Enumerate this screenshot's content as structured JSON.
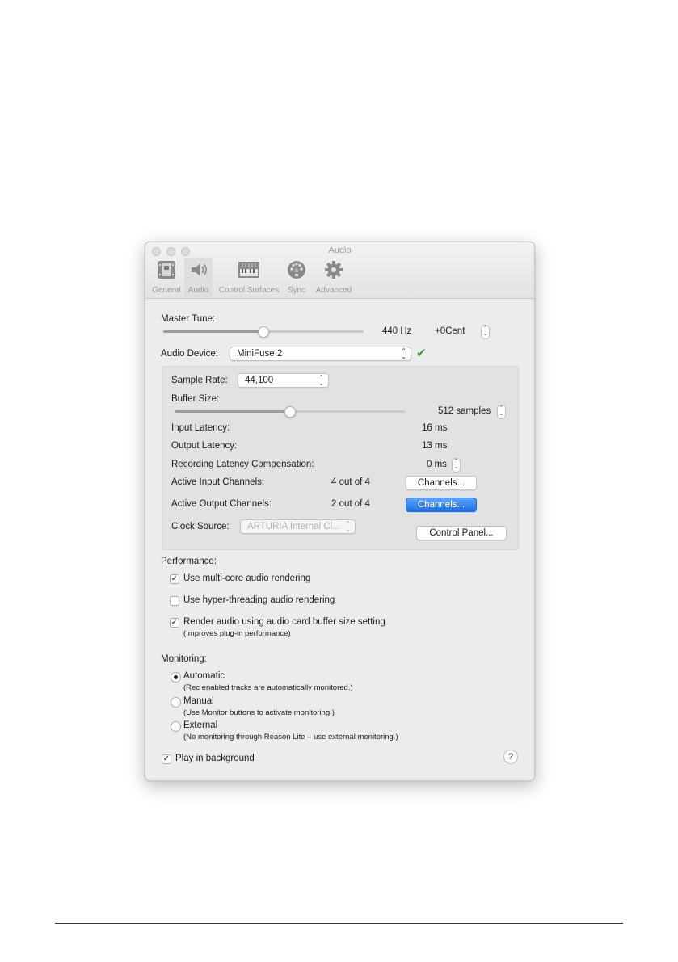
{
  "window": {
    "title": "Audio"
  },
  "tabs": [
    {
      "label": "General",
      "icon": "general-icon"
    },
    {
      "label": "Audio",
      "icon": "speaker-icon"
    },
    {
      "label": "Control Surfaces",
      "icon": "keyboard-icon"
    },
    {
      "label": "Sync",
      "icon": "midi-connector-icon"
    },
    {
      "label": "Advanced",
      "icon": "gear-icon"
    }
  ],
  "selected_tab": "Audio",
  "master_tune": {
    "label": "Master Tune:",
    "hz": "440 Hz",
    "cent": "+0Cent",
    "level": 0.5
  },
  "audio_device": {
    "label": "Audio Device:",
    "value": "MiniFuse 2",
    "status_icon": "checkmark-icon",
    "status_color": "#3a9a3a"
  },
  "device_settings": {
    "sample_rate_label": "Sample Rate:",
    "sample_rate_value": "44,100",
    "buffer_size_label": "Buffer Size:",
    "buffer_size_value": "512 samples",
    "buffer_level": 0.5,
    "input_latency_label": "Input Latency:",
    "input_latency_value": "16 ms",
    "output_latency_label": "Output Latency:",
    "output_latency_value": "13 ms",
    "rec_comp_label": "Recording Latency Compensation:",
    "rec_comp_value": "0 ms",
    "input_channels_label": "Active Input Channels:",
    "input_channels_value": "4 out of 4",
    "input_channels_button": "Channels...",
    "output_channels_label": "Active Output Channels:",
    "output_channels_value": "2 out of 4",
    "output_channels_button": "Channels...",
    "clock_source_label": "Clock Source:",
    "clock_source_value": "ARTURIA Internal Cl...",
    "control_panel_button": "Control Panel..."
  },
  "performance": {
    "heading": "Performance:",
    "options": [
      {
        "label": "Use multi-core audio rendering",
        "checked": true,
        "note": ""
      },
      {
        "label": "Use hyper-threading audio rendering",
        "checked": false,
        "note": ""
      },
      {
        "label": "Render audio using audio card buffer size setting",
        "checked": true,
        "note": "(Improves plug-in performance)"
      }
    ]
  },
  "monitoring": {
    "heading": "Monitoring:",
    "options": [
      {
        "label": "Automatic",
        "selected": true,
        "note": "(Rec enabled tracks are automatically monitored.)"
      },
      {
        "label": "Manual",
        "selected": false,
        "note": "(Use Monitor buttons to activate monitoring.)"
      },
      {
        "label": "External",
        "selected": false,
        "note": "(No monitoring through Reason Lite – use external monitoring.)"
      }
    ]
  },
  "play_in_background": {
    "label": "Play in background",
    "checked": true
  },
  "help": {
    "label": "?"
  },
  "colors": {
    "accent": "#1e6fe6",
    "window_bg": "#ececec",
    "group_bg": "#e2e2e2"
  }
}
